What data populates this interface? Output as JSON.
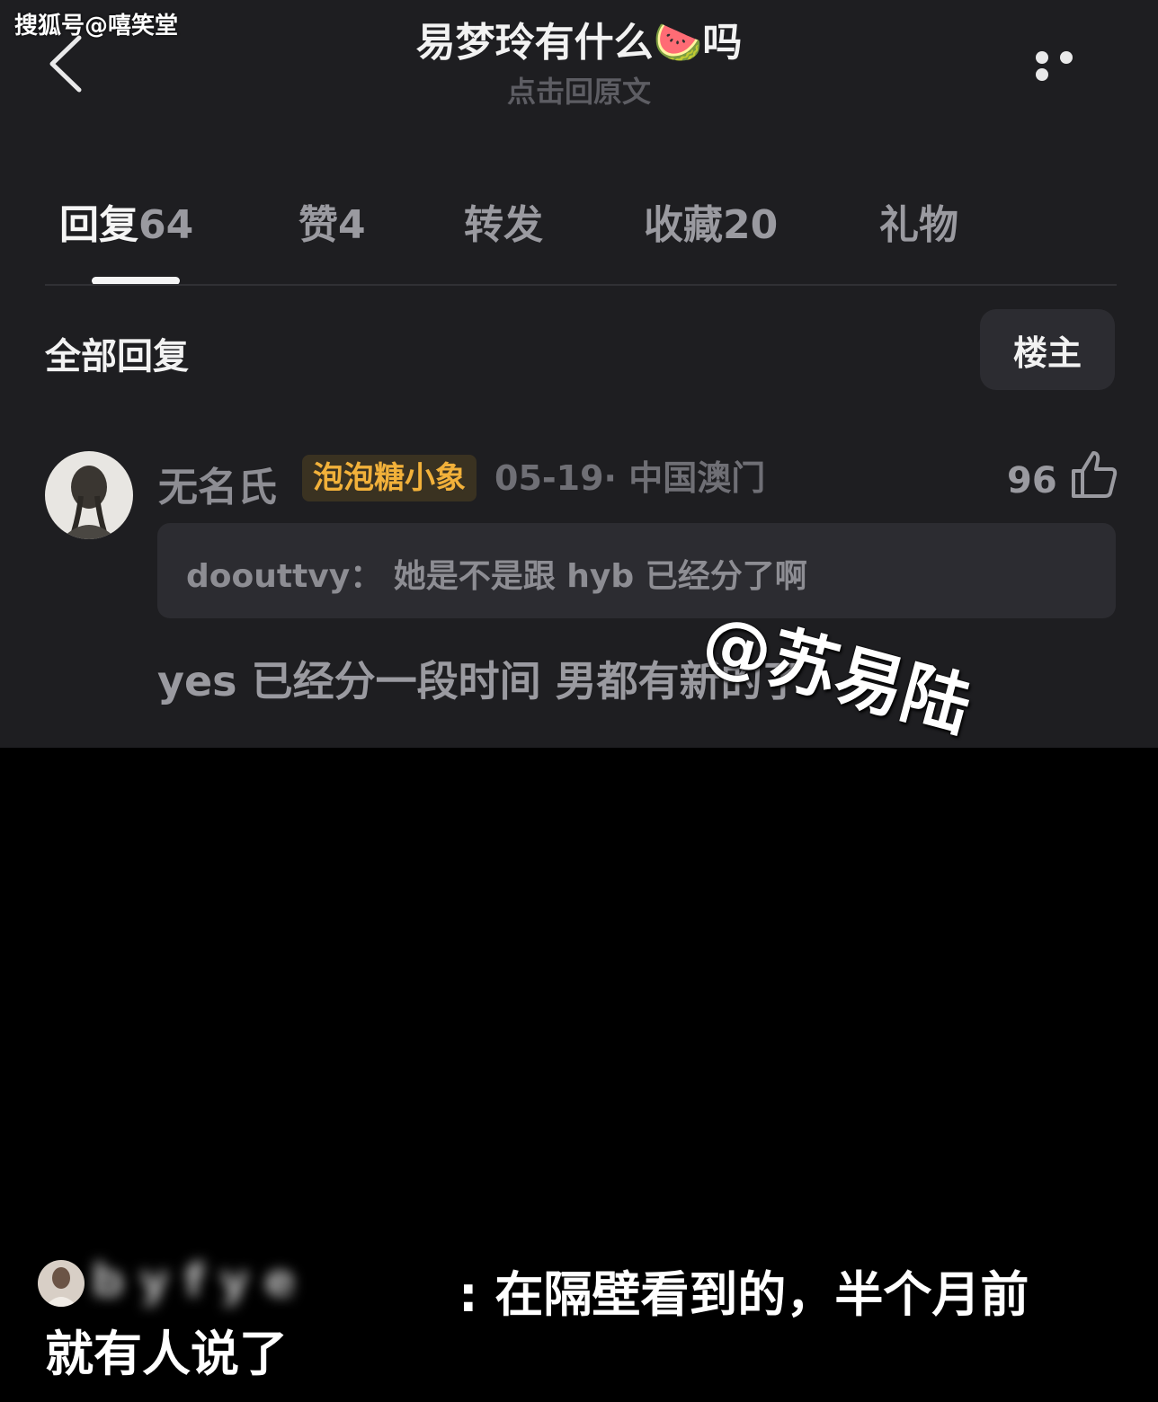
{
  "source_watermark": "搜狐号@嘻笑堂",
  "header": {
    "title": "易梦玲有什么🍉吗",
    "subtitle": "点击回原文",
    "back_icon": "chevron-left-icon",
    "more_icon": "more-horizontal-icon"
  },
  "tabs": [
    {
      "label": "回复",
      "count": "64",
      "active": true
    },
    {
      "label": "赞",
      "count": "4",
      "active": false
    },
    {
      "label": "转发",
      "count": "",
      "active": false
    },
    {
      "label": "收藏",
      "count": "20",
      "active": false
    },
    {
      "label": "礼物",
      "count": "",
      "active": false
    }
  ],
  "filter": {
    "all_replies": "全部回复",
    "op_button": "楼主"
  },
  "comment": {
    "username": "无名氏",
    "badge": "泡泡糖小象",
    "meta": "05-19· 中国澳门",
    "likes": "96",
    "quote_author": "doouttvy：",
    "quote_text": "她是不是跟 hyb 已经分了啊",
    "body": "yes 已经分一段时间 男都有新的了"
  },
  "overlay_watermark": "@苏易陆",
  "caption": {
    "blurred_name": "b   y  f   y  e",
    "line1": ": 在隔壁看到的，半个月前",
    "line2": "就有人说了"
  },
  "colors": {
    "panel_bg": "#1e1e21",
    "page_bg": "#000000",
    "badge_text": "#f2b13a",
    "badge_bg": "#3a3221"
  }
}
